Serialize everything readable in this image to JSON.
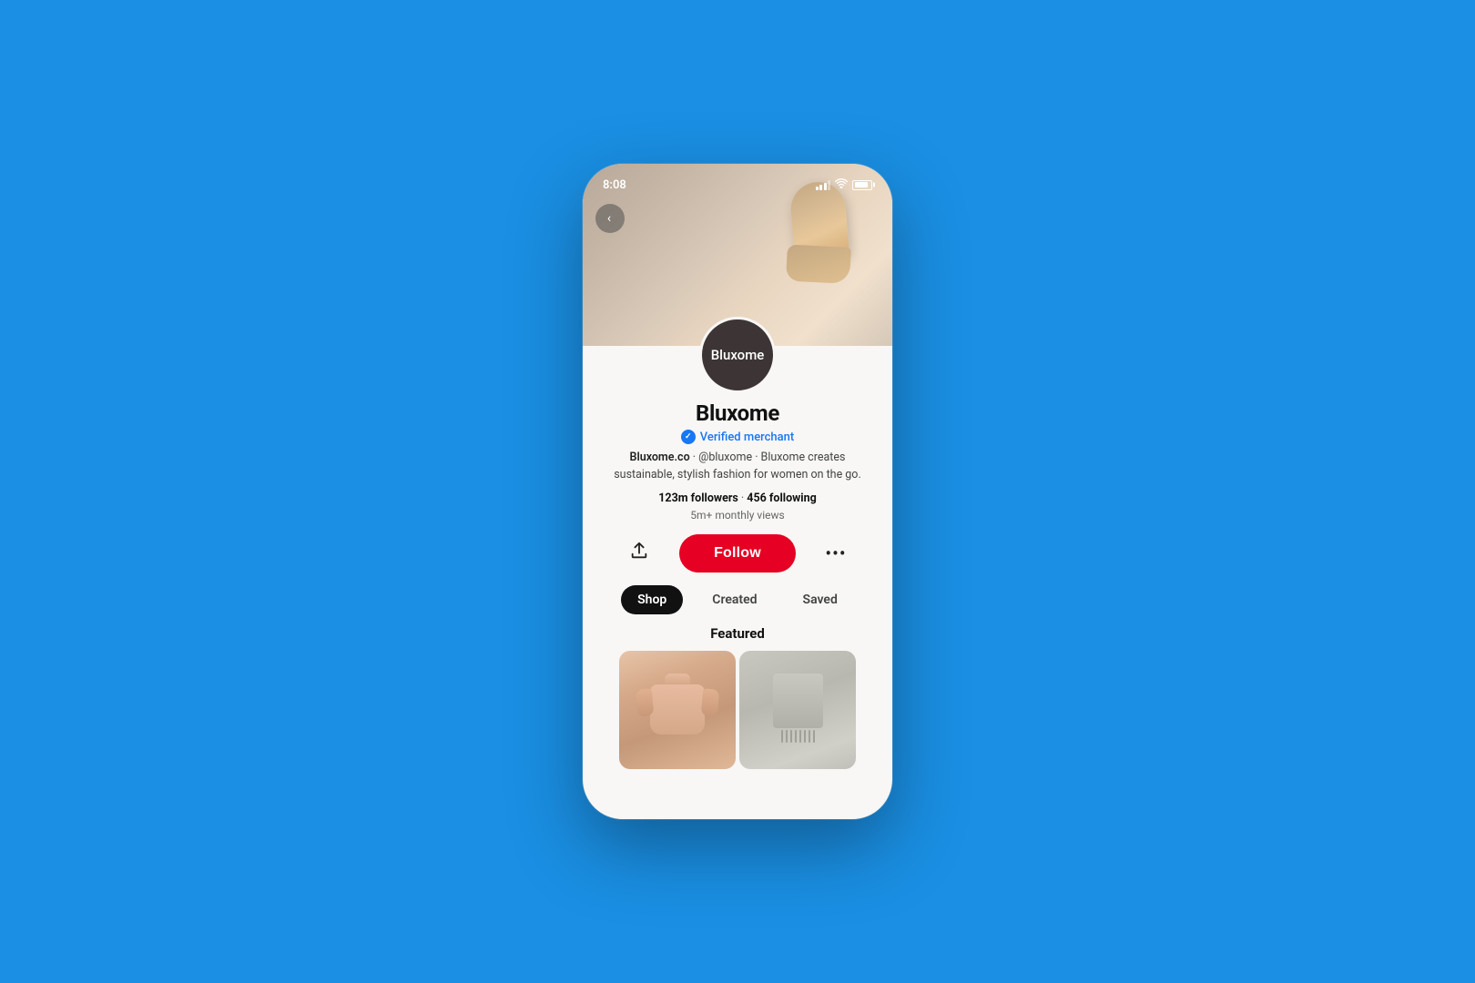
{
  "background": {
    "color": "#1a8fe3"
  },
  "statusBar": {
    "time": "8:08",
    "signal": "signal-icon",
    "wifi": "wifi-icon",
    "battery": "battery-icon"
  },
  "backButton": {
    "label": "‹"
  },
  "profile": {
    "name": "Bluxome",
    "avatarText": "Bluxome",
    "verifiedLabel": "Verified merchant",
    "bio": "Bluxome.co · @bluxome · Bluxome creates sustainable, stylish fashion for women on the go.",
    "followersLabel": "123m followers",
    "followingLabel": "456 following",
    "statsLabel": "123m followers · 456 following",
    "monthlyViews": "5m+ monthly views"
  },
  "actions": {
    "shareLabel": "share",
    "followLabel": "Follow",
    "moreLabel": "more"
  },
  "tabs": [
    {
      "label": "Shop",
      "active": true
    },
    {
      "label": "Created",
      "active": false
    },
    {
      "label": "Saved",
      "active": false
    }
  ],
  "featured": {
    "title": "Featured"
  }
}
